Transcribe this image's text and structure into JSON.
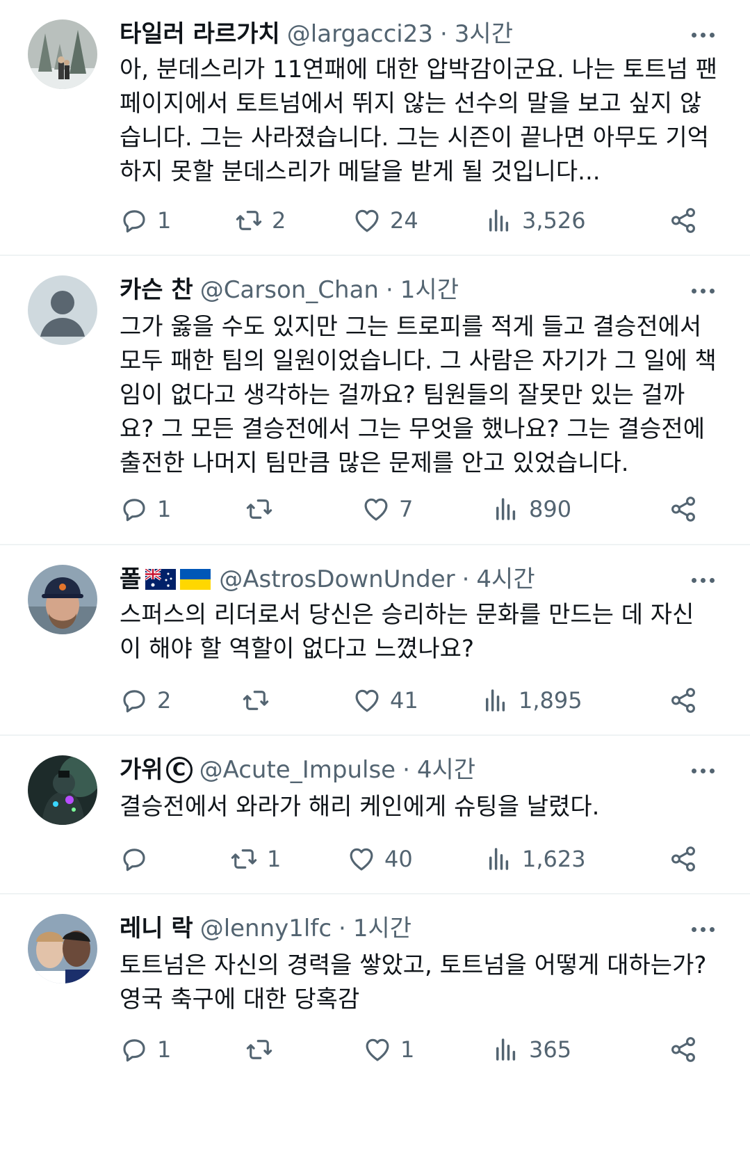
{
  "tweets": [
    {
      "name": "타일러 라르가치",
      "handle": "@largacci23",
      "time": "3시간",
      "text": "아, 분데스리가 11연패에 대한 압박감이군요. 나는 토트넘 팬\n페이지에서 토트넘에서 뛰지 않는 선수의 말을 보고 싶지 않\n습니다. 그는 사라졌습니다. 그는 시즌이 끝나면 아무도 기억\n하지 못할 분데스리가 메달을 받게 될 것입니다...",
      "replies": "1",
      "retweets": "2",
      "likes": "24",
      "views": "3,526",
      "avatar_icon": "snowy-forest-avatar"
    },
    {
      "name": "카슨 찬",
      "handle": "@Carson_Chan",
      "time": "1시간",
      "text": "그가 옳을 수도 있지만 그는 트로피를 적게 들고 결승전에서\n모두 패한 팀의 일원이었습니다. 그 사람은 자기가 그 일에 책\n임이 없다고 생각하는 걸까요? 팀원들의 잘못만 있는 걸까\n요? 그 모든 결승전에서 그는 무엇을 했나요? 그는 결승전에\n출전한 나머지 팀만큼 많은 문제를 안고 있었습니다.",
      "replies": "1",
      "retweets": "",
      "likes": "7",
      "views": "890",
      "avatar_icon": "default-user-avatar"
    },
    {
      "name": "폴",
      "flags": [
        "australia-flag-icon",
        "ukraine-flag-icon"
      ],
      "handle": "@AstrosDownUnder",
      "time": "4시간",
      "text": "스퍼스의 리더로서 당신은 승리하는 문화를 만드는 데 자신\n이 해야 할 역할이 없다고 느꼈나요?",
      "replies": "2",
      "retweets": "",
      "likes": "41",
      "views": "1,895",
      "avatar_icon": "cap-man-avatar"
    },
    {
      "name": "가위",
      "name_mark": "C",
      "handle": "@Acute_Impulse",
      "time": "4시간",
      "text": "결승전에서 와라가 해리 케인에게 슈팅을 날렸다.",
      "replies": "",
      "retweets": "1",
      "likes": "40",
      "views": "1,623",
      "avatar_icon": "neon-figure-avatar"
    },
    {
      "name": "레니 락",
      "handle": "@lenny1lfc",
      "time": "1시간",
      "text": "토트넘은 자신의 경력을 쌓았고, 토트넘을 어떻게 대하는가?\n영국 축구에 대한 당혹감",
      "replies": "1",
      "retweets": "",
      "likes": "1",
      "views": "365",
      "avatar_icon": "two-players-avatar"
    }
  ],
  "separator": "·",
  "colors": {
    "text": "#0f1419",
    "secondary": "#536471",
    "divider": "#eff3f4"
  }
}
